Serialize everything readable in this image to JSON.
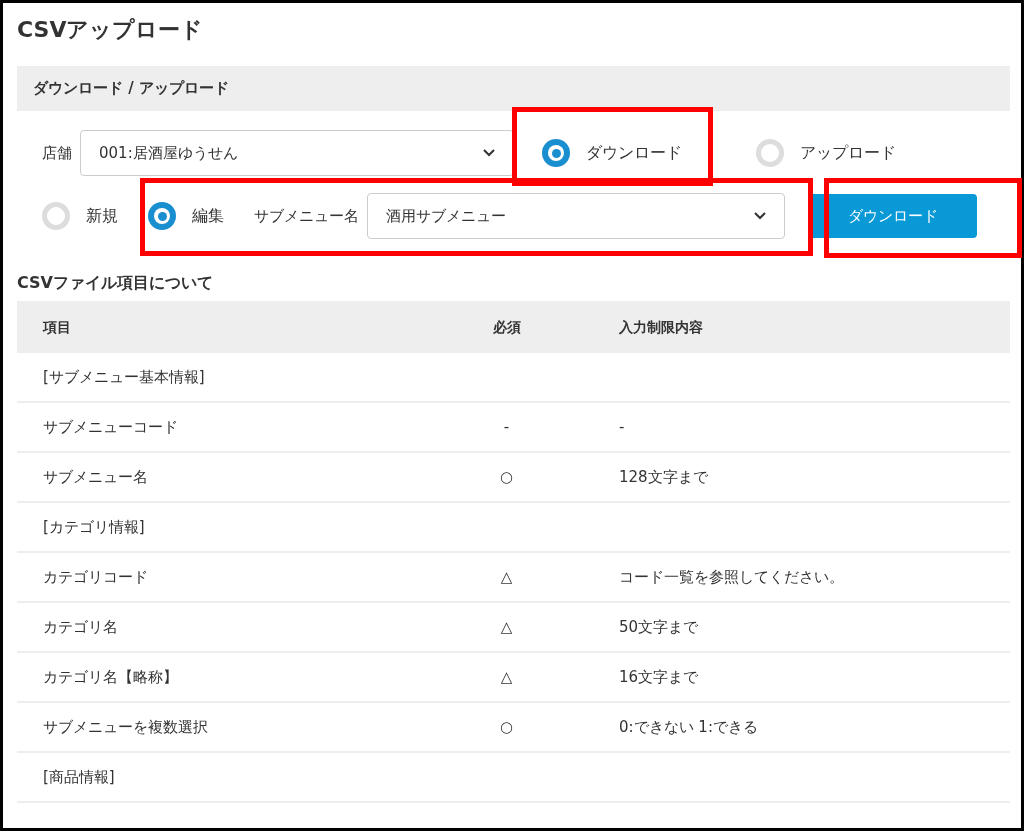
{
  "title": "CSVアップロード",
  "panel": {
    "title": "ダウンロード / アップロード",
    "store": {
      "label": "店舗",
      "value": "001:居酒屋ゆうせん"
    },
    "modes": [
      {
        "label": "ダウンロード",
        "selected": true
      },
      {
        "label": "アップロード",
        "selected": false
      }
    ],
    "types": [
      {
        "label": "新規",
        "selected": false
      },
      {
        "label": "編集",
        "selected": true
      }
    ],
    "submenu": {
      "label": "サブメニュー名",
      "value": "酒用サブメニュー"
    },
    "button": "ダウンロード"
  },
  "fields": {
    "title": "CSVファイル項目について",
    "columns": [
      "項目",
      "必須",
      "入力制限内容"
    ],
    "rows": [
      {
        "kind": "section",
        "item": "[サブメニュー基本情報]"
      },
      {
        "kind": "item",
        "item": "サブメニューコード",
        "required": "-",
        "limit": "-"
      },
      {
        "kind": "item",
        "item": "サブメニュー名",
        "required": "○",
        "limit": "128文字まで"
      },
      {
        "kind": "section",
        "item": "[カテゴリ情報]"
      },
      {
        "kind": "item",
        "item": "カテゴリコード",
        "required": "△",
        "limit": "コード一覧を参照してください。"
      },
      {
        "kind": "item",
        "item": "カテゴリ名",
        "required": "△",
        "limit": "50文字まで"
      },
      {
        "kind": "item",
        "item": "カテゴリ名【略称】",
        "required": "△",
        "limit": "16文字まで"
      },
      {
        "kind": "item",
        "item": "サブメニューを複数選択",
        "required": "○",
        "limit": "0:できない 1:できる"
      },
      {
        "kind": "section",
        "item": "[商品情報]"
      }
    ]
  }
}
